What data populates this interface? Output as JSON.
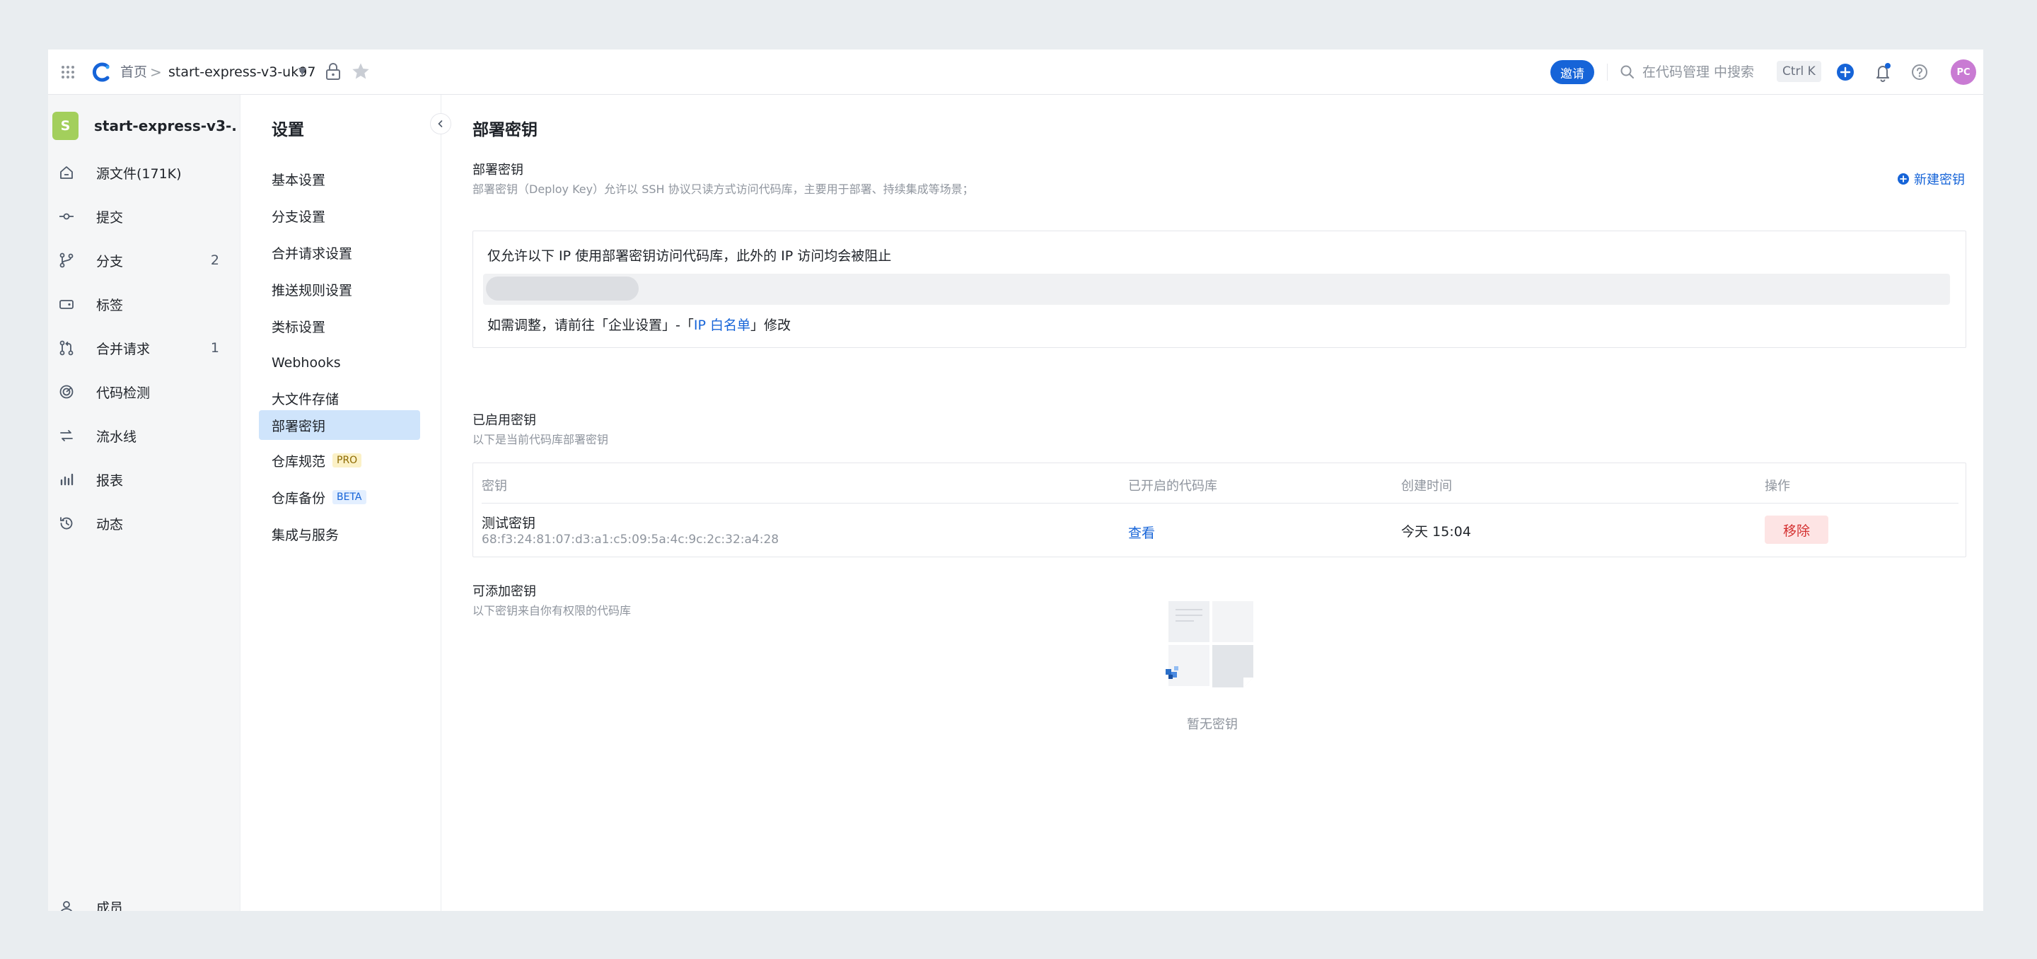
{
  "topbar": {
    "breadcrumb_home": "首页",
    "breadcrumb_sep": ">",
    "repo_name": "start-express-v3-uk97",
    "invite_label": "邀请",
    "search_placeholder": "在代码管理 中搜索",
    "shortcut": "Ctrl K",
    "avatar_text": "PC"
  },
  "sidebar": {
    "repo_initial": "S",
    "repo_name": "start-express-v3-...",
    "items": [
      {
        "label": "源文件(171K)",
        "icon": "home-icon",
        "count": ""
      },
      {
        "label": "提交",
        "icon": "commit-icon",
        "count": ""
      },
      {
        "label": "分支",
        "icon": "branch-icon",
        "count": "2"
      },
      {
        "label": "标签",
        "icon": "tag-icon",
        "count": ""
      },
      {
        "label": "合并请求",
        "icon": "merge-request-icon",
        "count": "1"
      },
      {
        "label": "代码检测",
        "icon": "scan-icon",
        "count": ""
      },
      {
        "label": "流水线",
        "icon": "pipeline-icon",
        "count": ""
      },
      {
        "label": "报表",
        "icon": "chart-icon",
        "count": ""
      },
      {
        "label": "动态",
        "icon": "history-icon",
        "count": ""
      }
    ],
    "bottom_item": "成员"
  },
  "settings": {
    "title": "设置",
    "items": [
      {
        "label": "基本设置"
      },
      {
        "label": "分支设置"
      },
      {
        "label": "合并请求设置"
      },
      {
        "label": "推送规则设置"
      },
      {
        "label": "类标设置"
      },
      {
        "label": "Webhooks"
      },
      {
        "label": "大文件存储"
      },
      {
        "label": "部署密钥"
      },
      {
        "label": "仓库规范",
        "badge": "PRO"
      },
      {
        "label": "仓库备份",
        "badge": "BETA"
      },
      {
        "label": "集成与服务"
      }
    ],
    "active_index": 7
  },
  "main": {
    "page_title": "部署密钥",
    "section_title": "部署密钥",
    "section_desc": "部署密钥（Deploy Key）允许以 SSH 协议只读方式访问代码库，主要用于部署、持续集成等场景；",
    "new_key_label": "新建密钥",
    "ip_notice": "仅允许以下 IP 使用部署密钥访问代码库，此外的 IP 访问均会被阻止",
    "ip_adjust_prefix": "如需调整，请前往「企业设置」-「",
    "ip_adjust_link": "IP 白名单",
    "ip_adjust_suffix": "」修改",
    "enabled_title": "已启用密钥",
    "enabled_desc": "以下是当前代码库部署密钥",
    "table_headers": {
      "key": "密钥",
      "repos": "已开启的代码库",
      "created": "创建时间",
      "actions": "操作"
    },
    "rows": [
      {
        "name": "测试密钥",
        "fingerprint": "68:f3:24:81:07:d3:a1:c5:09:5a:4c:9c:2c:32:a4:28",
        "view_label": "查看",
        "created": "今天 15:04",
        "remove_label": "移除"
      }
    ],
    "addable_title": "可添加密钥",
    "addable_desc": "以下密钥来自你有权限的代码库",
    "empty_text": "暂无密钥"
  },
  "colors": {
    "accent": "#1664d8",
    "active_bg": "#cfe4fb",
    "repo_avatar": "#a3cf5c",
    "danger": "#d43030"
  }
}
